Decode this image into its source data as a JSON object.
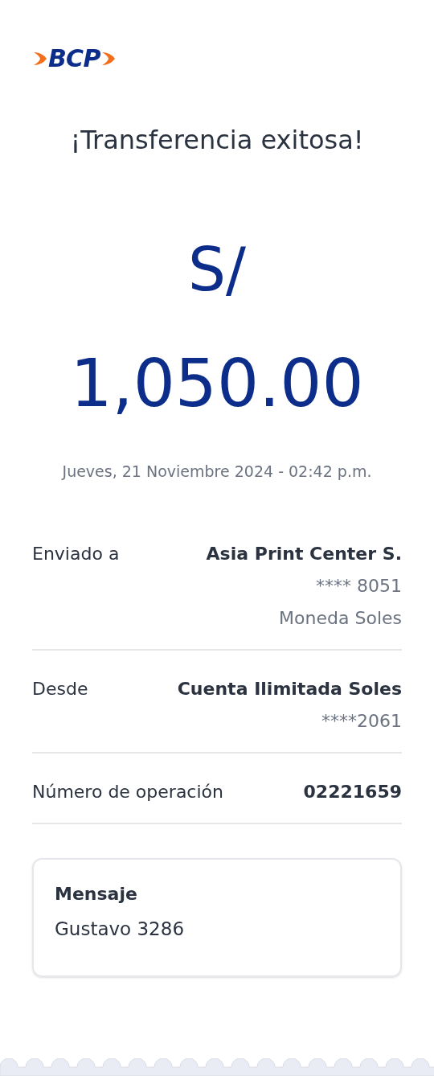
{
  "logo": {
    "text": "BCP"
  },
  "title": "¡Transferencia exitosa!",
  "amount": {
    "currency": "S/",
    "value": "1,050.00"
  },
  "date": "Jueves, 21 Noviembre 2024 - 02:42 p.m.",
  "details": [
    {
      "label": "Enviado a",
      "lines": [
        "Asia Print Center S.",
        "**** 8051",
        "Moneda Soles"
      ]
    },
    {
      "label": "Desde",
      "lines": [
        "Cuenta Ilimitada Soles",
        "****2061"
      ]
    },
    {
      "label": "Número de operación",
      "lines": [
        "02221659"
      ]
    }
  ],
  "message": {
    "title": "Mensaje",
    "text": "Gustavo 3286"
  }
}
